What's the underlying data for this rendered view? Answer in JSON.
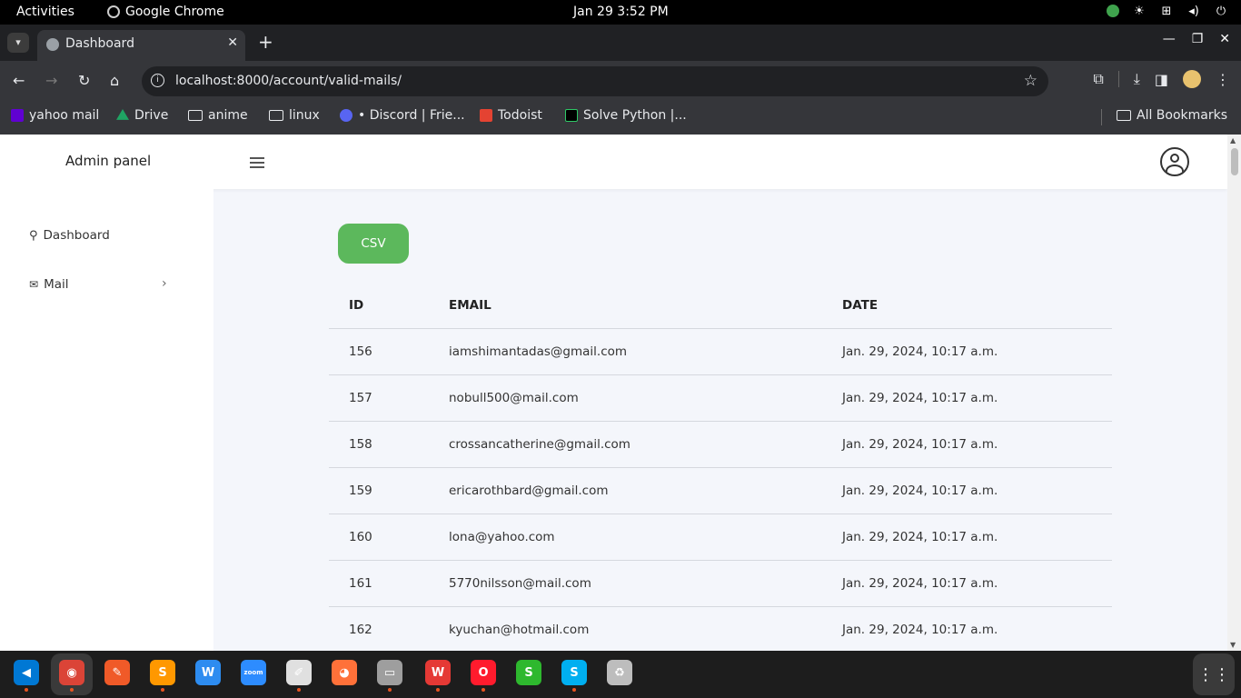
{
  "system": {
    "activities": "Activities",
    "app_name": "Google Chrome",
    "clock": "Jan 29   3:52 PM"
  },
  "browser": {
    "tab_title": "Dashboard",
    "url": "localhost:8000/account/valid-mails/",
    "bookmarks": [
      {
        "label": "yahoo mail",
        "icon": "yahoo-icon",
        "color": "#6001d2"
      },
      {
        "label": "Drive",
        "icon": "drive-icon",
        "color": "#1fa463"
      },
      {
        "label": "anime",
        "icon": "folder-icon"
      },
      {
        "label": "linux",
        "icon": "folder-icon"
      },
      {
        "label": "• Discord | Frie...",
        "icon": "discord-icon",
        "color": "#5865f2"
      },
      {
        "label": "Todoist",
        "icon": "todoist-icon",
        "color": "#e44332"
      },
      {
        "label": "Solve Python |...",
        "icon": "hackerrank-icon",
        "color": "#000000"
      }
    ],
    "all_bookmarks": "All Bookmarks"
  },
  "page": {
    "brand": "Admin panel",
    "sidebar": {
      "items": [
        {
          "label": "Dashboard",
          "icon": "dashboard-icon"
        },
        {
          "label": "Mail",
          "icon": "mail-icon"
        }
      ]
    },
    "csv_button": "CSV",
    "accent_color": "#5cb85c",
    "table": {
      "headers": [
        "ID",
        "EMAIL",
        "DATE"
      ],
      "rows": [
        {
          "id": "156",
          "email": "iamshimantadas@gmail.com",
          "date": "Jan. 29, 2024, 10:17 a.m."
        },
        {
          "id": "157",
          "email": "nobull500@mail.com",
          "date": "Jan. 29, 2024, 10:17 a.m."
        },
        {
          "id": "158",
          "email": "crossancatherine@gmail.com",
          "date": "Jan. 29, 2024, 10:17 a.m."
        },
        {
          "id": "159",
          "email": "ericarothbard@gmail.com",
          "date": "Jan. 29, 2024, 10:17 a.m."
        },
        {
          "id": "160",
          "email": "lona@yahoo.com",
          "date": "Jan. 29, 2024, 10:17 a.m."
        },
        {
          "id": "161",
          "email": "5770nilsson@mail.com",
          "date": "Jan. 29, 2024, 10:17 a.m."
        },
        {
          "id": "162",
          "email": "kyuchan@hotmail.com",
          "date": "Jan. 29, 2024, 10:17 a.m."
        }
      ]
    }
  },
  "dock": {
    "apps": [
      {
        "icon": "vscode-icon",
        "color": "#0078d4",
        "glyph": "◀",
        "running": true
      },
      {
        "icon": "chrome-icon",
        "color": "#db4437",
        "glyph": "◉",
        "running": true
      },
      {
        "icon": "brush-icon",
        "color": "#f05a28",
        "glyph": "✎",
        "running": false
      },
      {
        "icon": "sublime-icon",
        "color": "#ff9800",
        "glyph": "S",
        "running": true
      },
      {
        "icon": "wps-writer-icon",
        "color": "#2d8cf0",
        "glyph": "W",
        "running": false
      },
      {
        "icon": "zoom-icon",
        "color": "#2d8cff",
        "glyph": "zoom",
        "running": false
      },
      {
        "icon": "text-editor-icon",
        "color": "#e0e0e0",
        "glyph": "✐",
        "running": true
      },
      {
        "icon": "firefox-icon",
        "color": "#ff7139",
        "glyph": "◕",
        "running": false
      },
      {
        "icon": "files-icon",
        "color": "#9e9e9e",
        "glyph": "▭",
        "running": true
      },
      {
        "icon": "wps-office-icon",
        "color": "#e53935",
        "glyph": "W",
        "running": true
      },
      {
        "icon": "opera-icon",
        "color": "#ff1b2d",
        "glyph": "O",
        "running": true
      },
      {
        "icon": "spreadsheet-icon",
        "color": "#2eb82e",
        "glyph": "S",
        "running": false
      },
      {
        "icon": "skype-icon",
        "color": "#00aff0",
        "glyph": "S",
        "running": true
      },
      {
        "icon": "trash-icon",
        "color": "#bdbdbd",
        "glyph": "♻",
        "running": false
      }
    ]
  }
}
